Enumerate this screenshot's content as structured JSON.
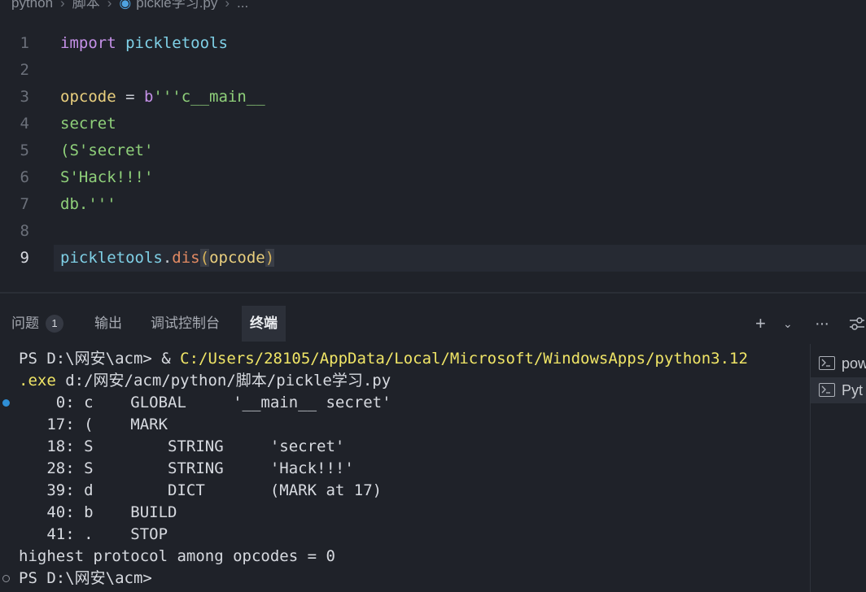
{
  "breadcrumb": {
    "items": [
      "python",
      "脚本",
      "pickle学习.py",
      "..."
    ]
  },
  "editor": {
    "lines": [
      {
        "num": "1",
        "tokens": [
          [
            "import",
            "kw"
          ],
          [
            " ",
            "op"
          ],
          [
            "pickletools",
            "mod"
          ]
        ]
      },
      {
        "num": "2",
        "tokens": []
      },
      {
        "num": "3",
        "tokens": [
          [
            "opcode",
            "var"
          ],
          [
            " = ",
            "op"
          ],
          [
            "b",
            "kw"
          ],
          [
            "'''c__main__",
            "str"
          ]
        ]
      },
      {
        "num": "4",
        "tokens": [
          [
            "secret",
            "str"
          ]
        ]
      },
      {
        "num": "5",
        "tokens": [
          [
            "(S'secret'",
            "str"
          ]
        ]
      },
      {
        "num": "6",
        "tokens": [
          [
            "S'Hack!!!'",
            "str"
          ]
        ]
      },
      {
        "num": "7",
        "tokens": [
          [
            "db.'''",
            "str"
          ]
        ]
      },
      {
        "num": "8",
        "tokens": []
      },
      {
        "num": "9",
        "tokens": [
          [
            "pickletools",
            "mod"
          ],
          [
            ".",
            "op"
          ],
          [
            "dis",
            "fn"
          ],
          [
            "(",
            "paren"
          ],
          [
            "opcode",
            "var"
          ],
          [
            ")",
            "paren"
          ]
        ]
      }
    ],
    "current_line": "9"
  },
  "panel": {
    "tabs": {
      "problems": "问题",
      "problems_count": "1",
      "output": "输出",
      "debug_console": "调试控制台",
      "terminal": "终端"
    },
    "icons": [
      "plus-icon",
      "chevron-down-icon",
      "more-icon",
      "sliders-icon"
    ]
  },
  "terminal": {
    "prompt1": "PS D:\\网安\\acm> & ",
    "cmd_path": "C:/Users/28105/AppData/Local/Microsoft/WindowsApps/python3.12",
    "cmd_path2": ".exe",
    "cmd_rest": " d:/网安/acm/python/脚本/pickle学习.py",
    "output": [
      "    0: c    GLOBAL     '__main__ secret'",
      "   17: (    MARK",
      "   18: S        STRING     'secret'",
      "   28: S        STRING     'Hack!!!'",
      "   39: d        DICT       (MARK at 17)",
      "   40: b    BUILD",
      "   41: .    STOP",
      "highest protocol among opcodes = 0"
    ],
    "prompt2": "PS D:\\网安\\acm>"
  },
  "terminal_list": {
    "items": [
      {
        "label": "pow",
        "icon": "terminal-icon"
      },
      {
        "label": "Pyt",
        "icon": "terminal-icon"
      }
    ]
  }
}
